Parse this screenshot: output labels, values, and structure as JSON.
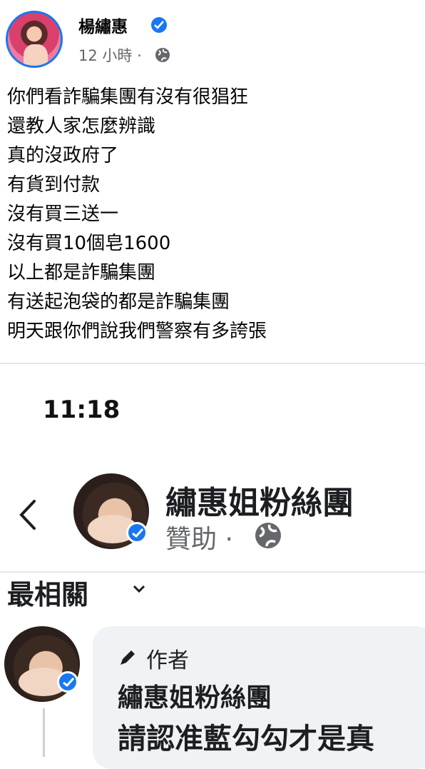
{
  "post": {
    "author": "楊繡惠",
    "time": "12 小時 ·",
    "lines": [
      "你們看詐騙集團有沒有很猖狂",
      "還教人家怎麼辨識",
      "真的沒政府了",
      "有貨到付款",
      "沒有買三送一",
      "沒有買10個皂1600",
      "以上都是詐騙集團",
      "有送起泡袋的都是詐騙集團",
      "明天跟你們說我們警察有多誇張"
    ]
  },
  "screenshot": {
    "clock": "11:18",
    "page_name": "繡惠姐粉絲團",
    "sponsored": "贊助 ·",
    "sort_label": "最相關",
    "comment": {
      "author_tag": "作者",
      "name": "繡惠姐粉絲團",
      "text": "請認准藍勾勾才是真"
    }
  },
  "colors": {
    "brand_blue": "#1877f2",
    "meta_gray": "#65676b",
    "bubble_bg": "#f0f2f5"
  },
  "icons": [
    "verified-badge-icon",
    "globe-icon",
    "back-chevron-icon",
    "chevron-down-icon",
    "pencil-icon"
  ]
}
